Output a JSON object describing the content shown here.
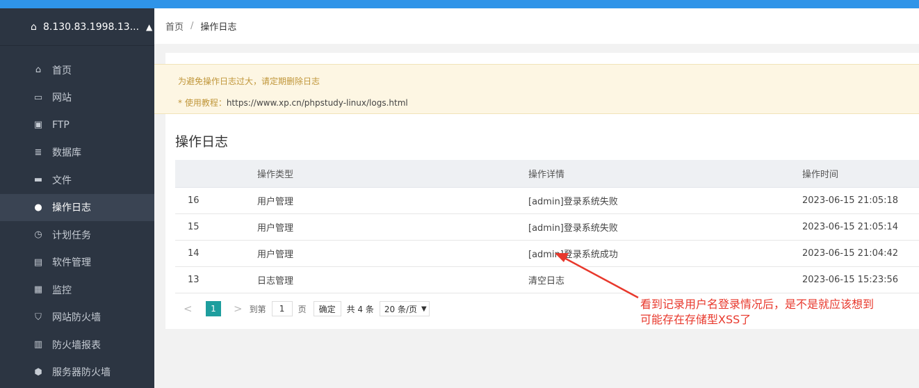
{
  "sidebar": {
    "host": "8.130.83.1998.13...",
    "items": [
      {
        "label": "首页",
        "icon": "home-icon",
        "glyph": "⌂"
      },
      {
        "label": "网站",
        "icon": "monitor-icon",
        "glyph": "▭"
      },
      {
        "label": "FTP",
        "icon": "ftp-icon",
        "glyph": "▣"
      },
      {
        "label": "数据库",
        "icon": "database-icon",
        "glyph": "≣"
      },
      {
        "label": "文件",
        "icon": "folder-icon",
        "glyph": "▬"
      },
      {
        "label": "操作日志",
        "icon": "log-icon",
        "glyph": "●"
      },
      {
        "label": "计划任务",
        "icon": "clock-icon",
        "glyph": "◷"
      },
      {
        "label": "软件管理",
        "icon": "software-icon",
        "glyph": "▤"
      },
      {
        "label": "监控",
        "icon": "monitor-chart-icon",
        "glyph": "▦"
      },
      {
        "label": "网站防火墙",
        "icon": "shield-icon",
        "glyph": "⛉"
      },
      {
        "label": "防火墙报表",
        "icon": "report-icon",
        "glyph": "▥"
      },
      {
        "label": "服务器防火墙",
        "icon": "server-shield-icon",
        "glyph": "⬢"
      }
    ]
  },
  "breadcrumb": {
    "home": "首页",
    "sep": "/",
    "current": "操作日志"
  },
  "notice": {
    "line1": "为避免操作日志过大，请定期删除日志",
    "line2_prefix": "* 使用教程：",
    "line2_url": "https://www.xp.cn/phpstudy-linux/logs.html"
  },
  "page_title": "操作日志",
  "table": {
    "headers": [
      "",
      "操作类型",
      "操作详情",
      "操作时间"
    ],
    "rows": [
      [
        "16",
        "用户管理",
        "[admin]登录系统失败",
        "2023-06-15 21:05:18"
      ],
      [
        "15",
        "用户管理",
        "[admin]登录系统失败",
        "2023-06-15 21:05:14"
      ],
      [
        "14",
        "用户管理",
        "[admin]登录系统成功",
        "2023-06-15 21:04:42"
      ],
      [
        "13",
        "日志管理",
        "清空日志",
        "2023-06-15 15:23:56"
      ]
    ]
  },
  "pager": {
    "prev": "<",
    "current": "1",
    "next": ">",
    "goto_label": "到第",
    "goto_value": "1",
    "page_label": "页",
    "confirm": "确定",
    "total": "共 4 条",
    "page_size": "20 条/页"
  },
  "annotation": {
    "line1": "看到记录用户名登录情况后，是不是就应该想到",
    "line2": "可能存在存储型XSS了",
    "color": "#e8382c"
  },
  "colors": {
    "topbar": "#2f94e8",
    "sidebar": "#2c3542",
    "accent": "#1e9e9e"
  }
}
